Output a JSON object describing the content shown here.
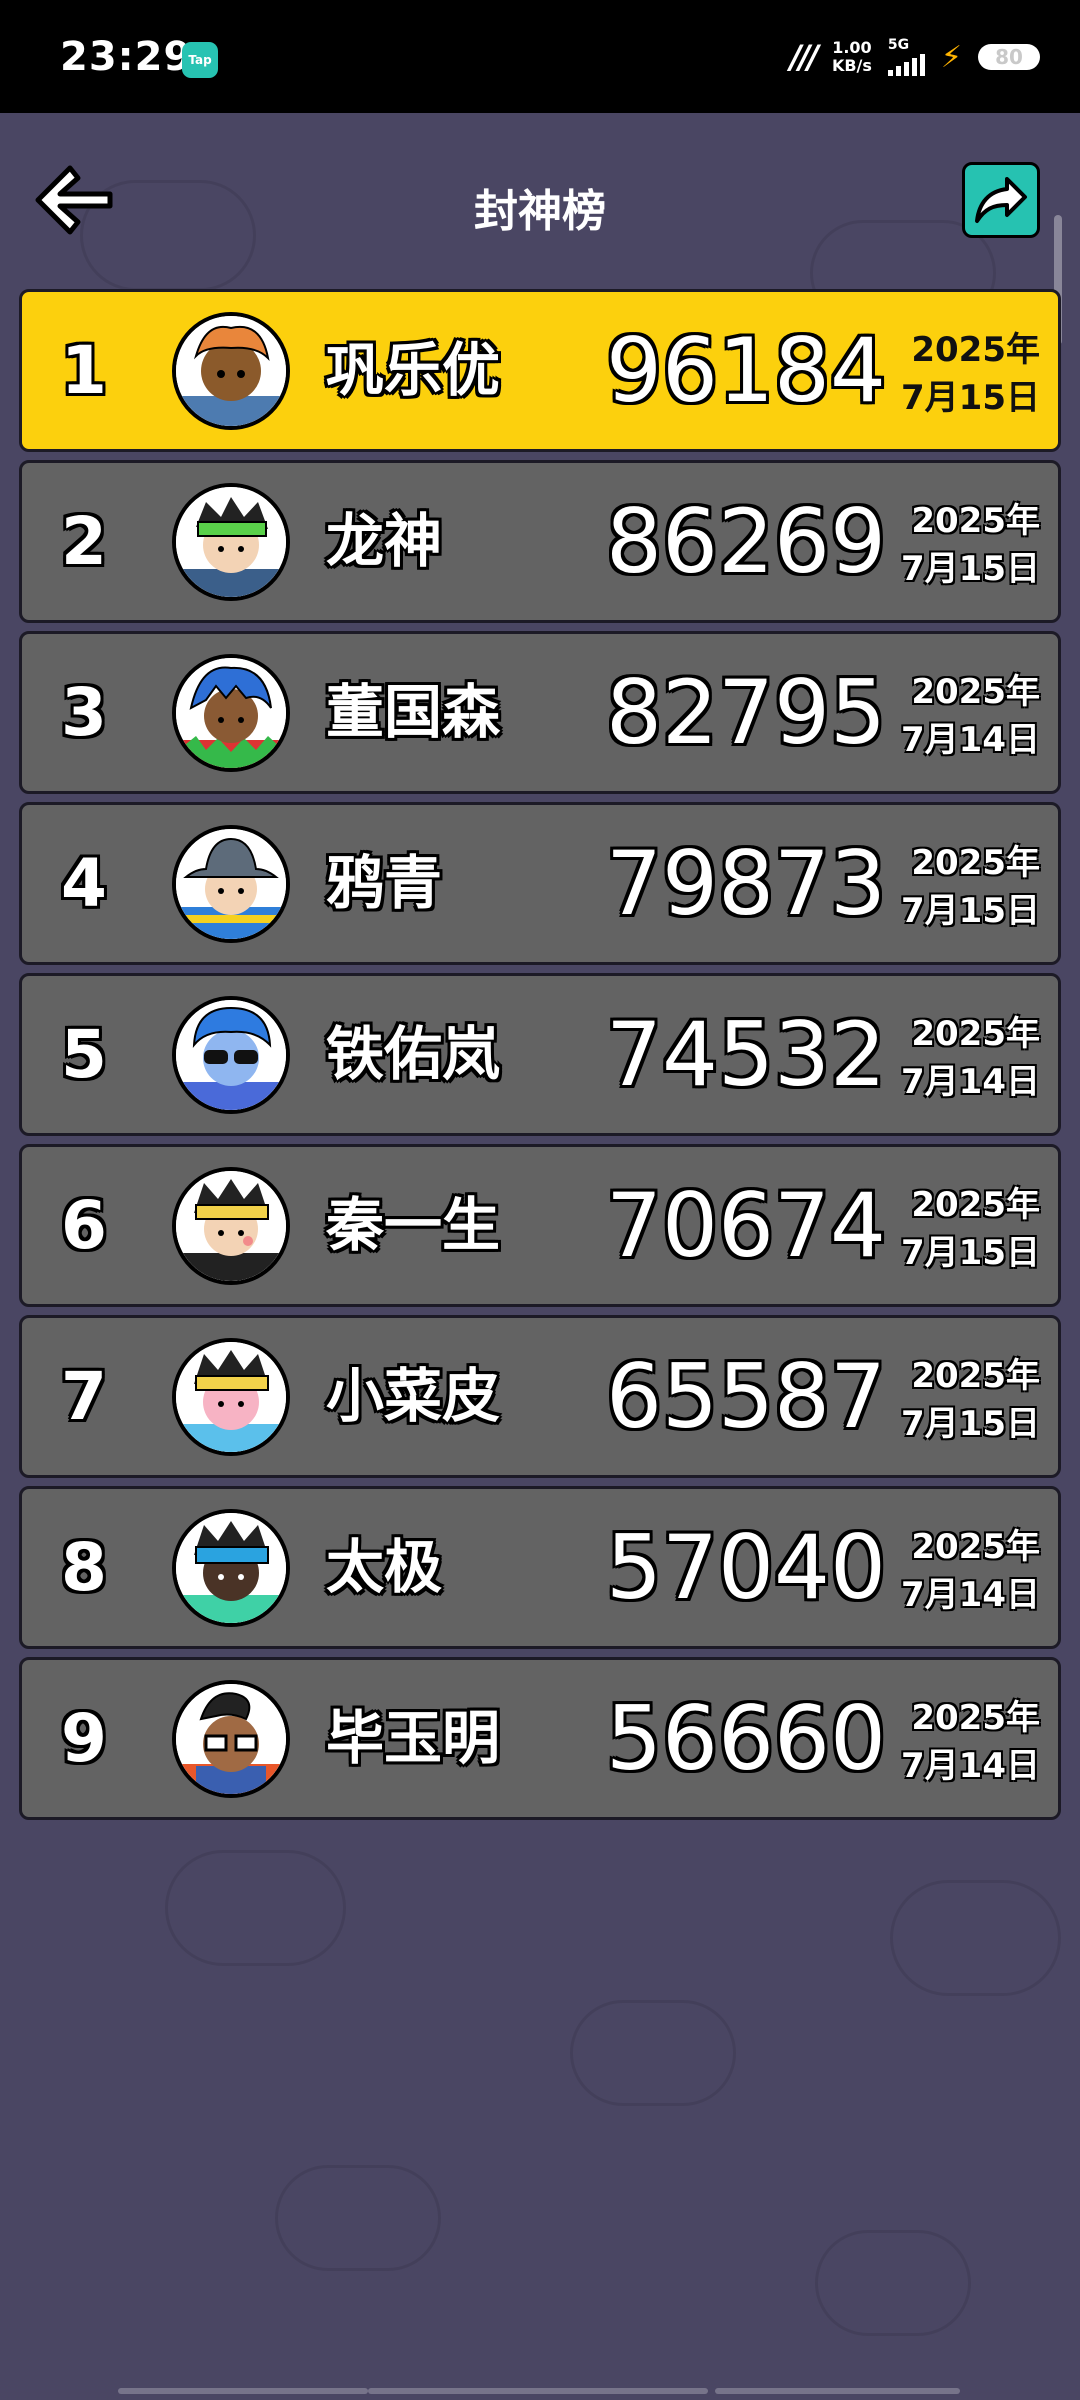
{
  "status_bar": {
    "time": "23:29",
    "app_badge": "Tap",
    "network_speed_value": "1.00",
    "network_speed_unit": "KB/s",
    "signal_label": "5G",
    "battery": "80"
  },
  "header": {
    "title": "封神榜",
    "back_icon": "arrow-left-icon",
    "share_icon": "share-icon"
  },
  "colors": {
    "background": "#4a4663",
    "row": "#636363",
    "first_row": "#fcd00d",
    "share_button": "#26c2b1"
  },
  "leaderboard": [
    {
      "rank": "1",
      "name": "巩乐优",
      "score": "96184",
      "year": "2025年",
      "day": "7月15日",
      "avatar": "orange-hair-avatar"
    },
    {
      "rank": "2",
      "name": "龙神",
      "score": "86269",
      "year": "2025年",
      "day": "7月15日",
      "avatar": "green-headband-avatar"
    },
    {
      "rank": "3",
      "name": "董国森",
      "score": "82795",
      "year": "2025年",
      "day": "7月14日",
      "avatar": "blue-hair-avatar"
    },
    {
      "rank": "4",
      "name": "鸦青",
      "score": "79873",
      "year": "2025年",
      "day": "7月15日",
      "avatar": "bucket-hat-avatar"
    },
    {
      "rank": "5",
      "name": "铁佑岚",
      "score": "74532",
      "year": "2025年",
      "day": "7月14日",
      "avatar": "sunglasses-avatar"
    },
    {
      "rank": "6",
      "name": "秦一生",
      "score": "70674",
      "year": "2025年",
      "day": "7月15日",
      "avatar": "yellow-headband-avatar"
    },
    {
      "rank": "7",
      "name": "小菜皮",
      "score": "65587",
      "year": "2025年",
      "day": "7月15日",
      "avatar": "pink-face-avatar"
    },
    {
      "rank": "8",
      "name": "太极",
      "score": "57040",
      "year": "2025年",
      "day": "7月14日",
      "avatar": "blue-cap-avatar"
    },
    {
      "rank": "9",
      "name": "毕玉明",
      "score": "56660",
      "year": "2025年",
      "day": "7月14日",
      "avatar": "glasses-avatar"
    }
  ]
}
